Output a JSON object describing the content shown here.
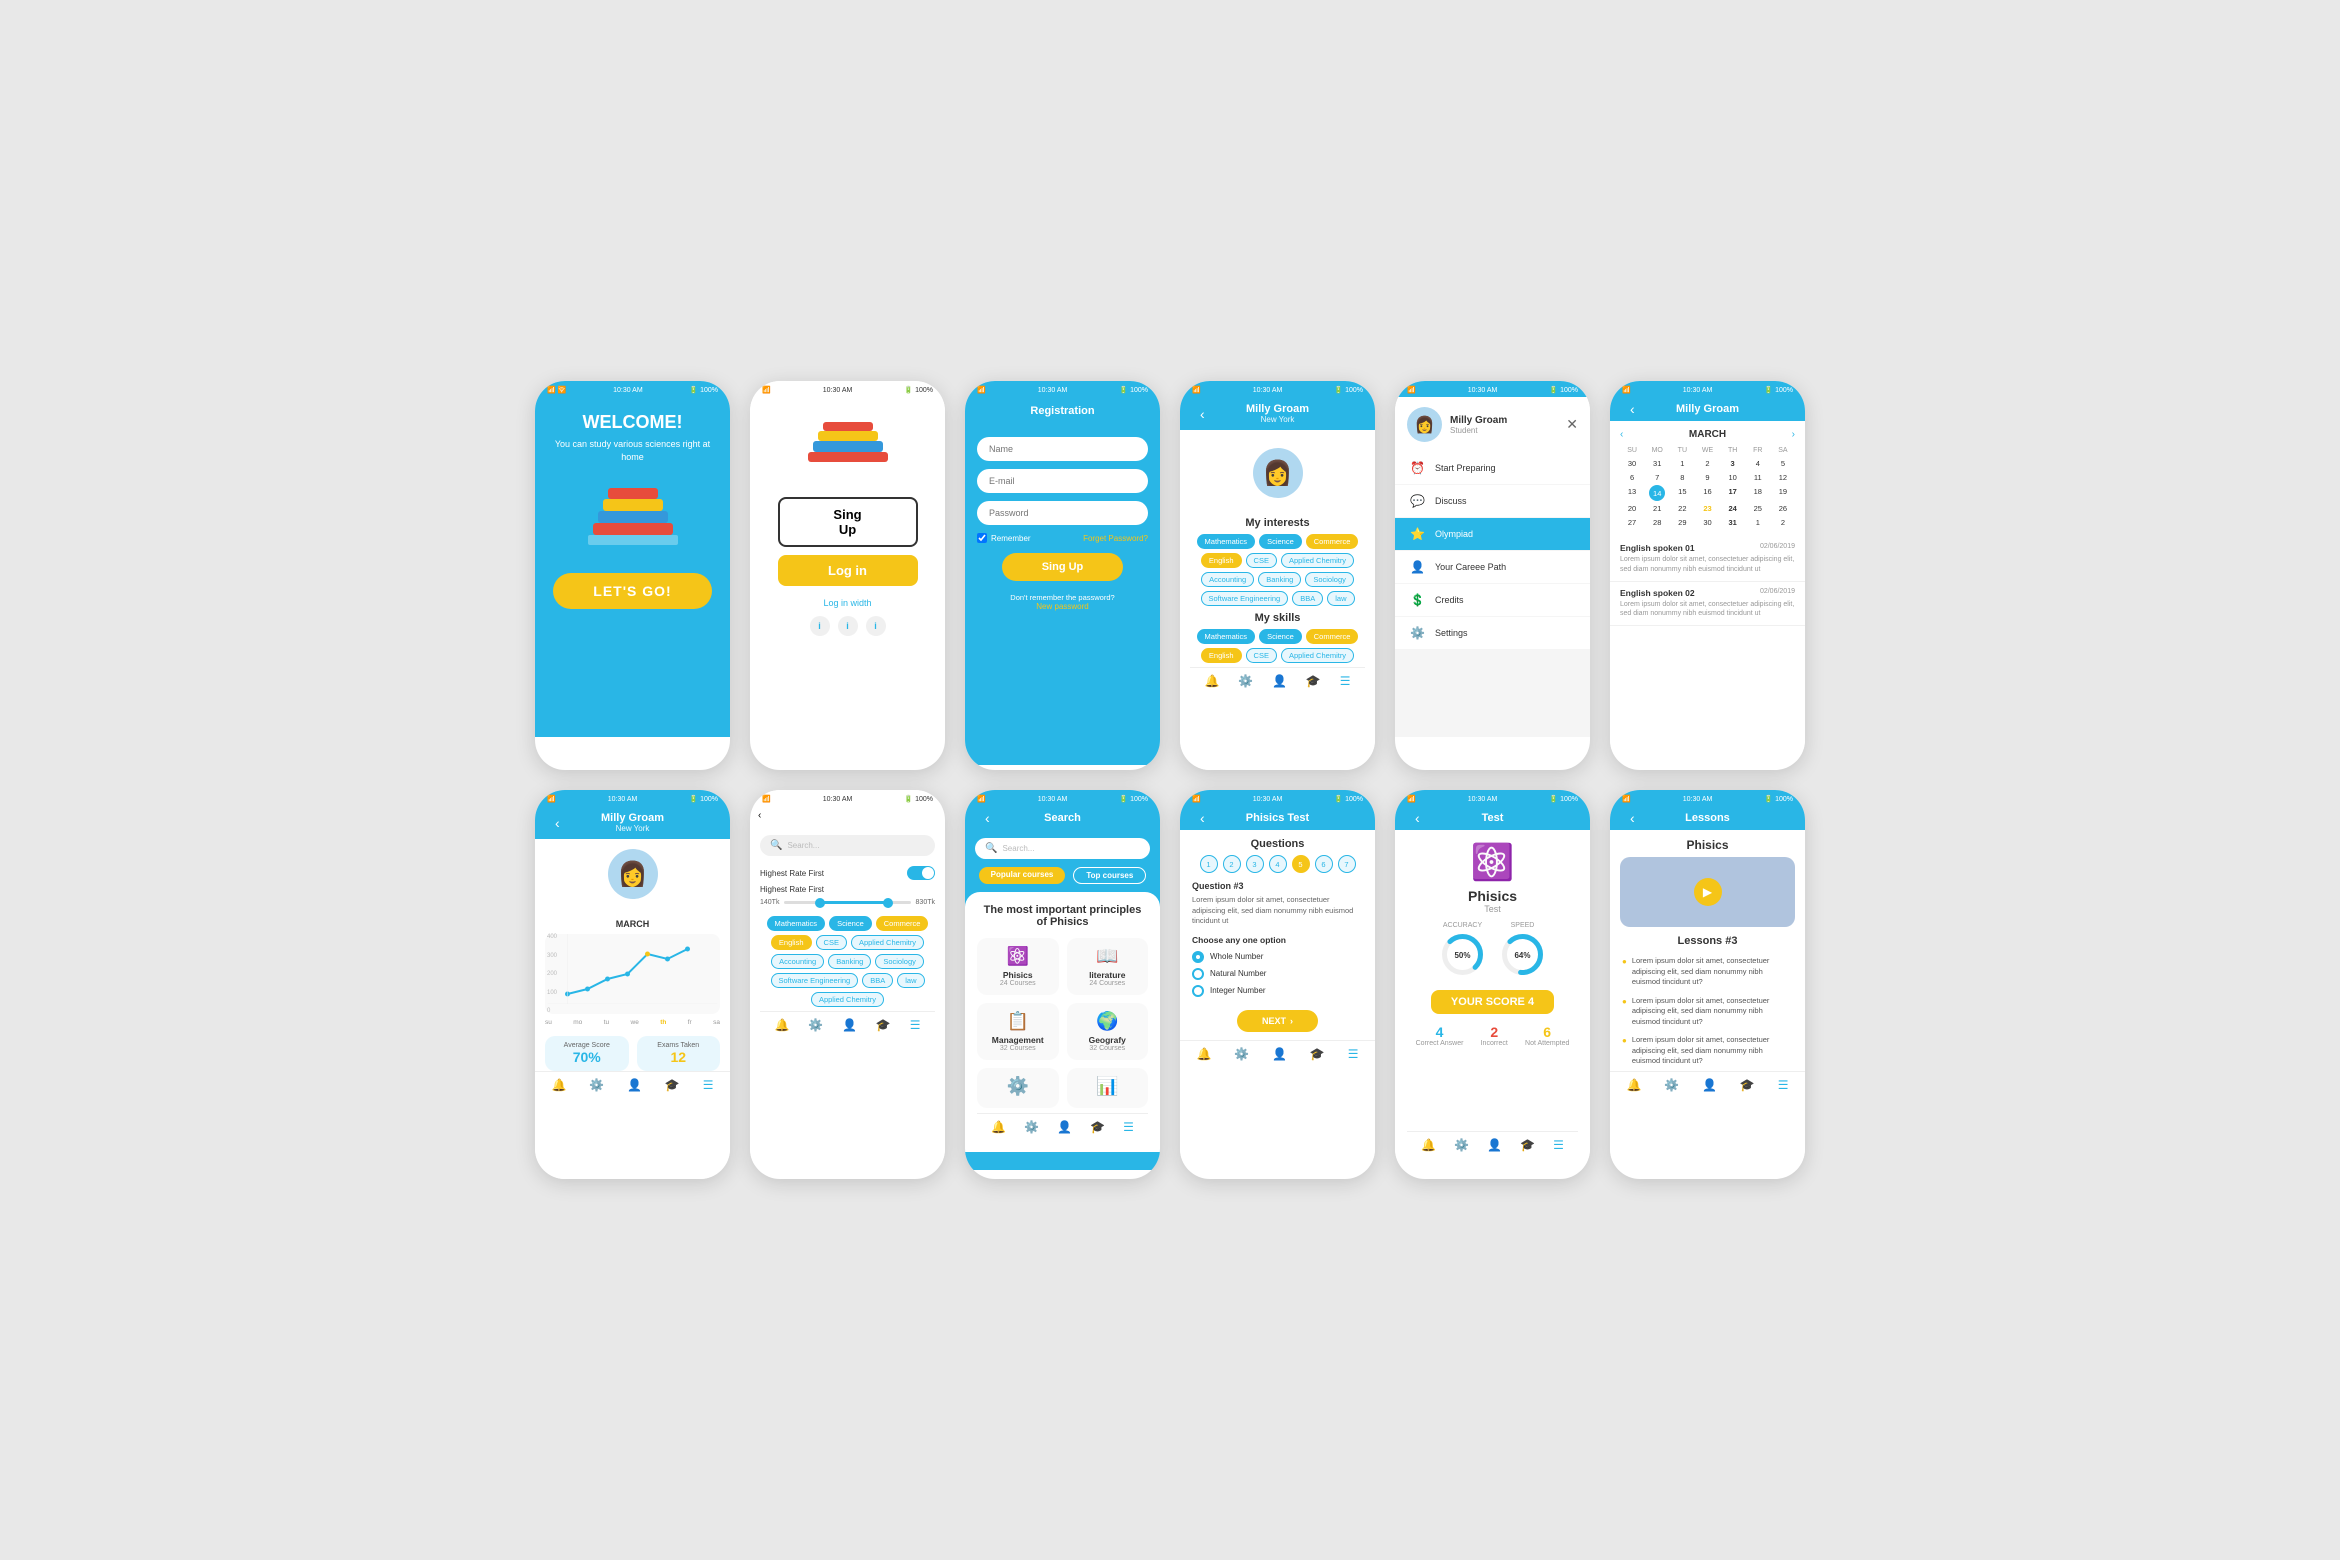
{
  "phones": {
    "welcome": {
      "status": "10:30 AM",
      "battery": "100%",
      "title": "WELCOME!",
      "subtitle": "You can study various sciences right at home",
      "cta": "LET'S GO!"
    },
    "login": {
      "status": "10:30 AM",
      "battery": "100%",
      "signup_btn": "Sing Up",
      "login_btn": "Log in",
      "login_with": "Log in width"
    },
    "registration": {
      "status": "10:30 AM",
      "battery": "100%",
      "title": "Registration",
      "name_placeholder": "Name",
      "email_placeholder": "E-mail",
      "password_placeholder": "Password",
      "remember": "Remember",
      "forgot": "Forget Password?",
      "signup_btn": "Sing Up",
      "forgot_text": "Don't remember the password?",
      "new_password": "New password"
    },
    "interests": {
      "status": "10:30 AM",
      "battery": "100%",
      "header": "Milly Groam",
      "header_sub": "New York",
      "interests_title": "My interests",
      "interests_tags": [
        "Mathematics",
        "Science",
        "Commerce",
        "English",
        "CSE",
        "Applied Chemitry",
        "Accounting",
        "Banking",
        "Sociology",
        "Software Engineering",
        "BBA",
        "law"
      ],
      "skills_title": "My skills",
      "skills_tags": [
        "Mathematics",
        "Science",
        "Commerce",
        "English",
        "CSE",
        "Applied Chemitry"
      ]
    },
    "menu": {
      "status": "10:30 AM",
      "battery": "100%",
      "user_name": "Milly Groam",
      "user_role": "Student",
      "items": [
        "Start Preparing",
        "Discuss",
        "Olympiad",
        "Your Career Path",
        "Credits",
        "Settings"
      ]
    },
    "calendar": {
      "status": "10:30 AM",
      "battery": "100%",
      "header": "Milly Groam",
      "month": "MARCH",
      "days_header": [
        "SU",
        "MO",
        "TU",
        "WE",
        "TH",
        "FR",
        "SA"
      ],
      "events": [
        {
          "title": "English spoken 01",
          "date": "02/06/2019",
          "desc": "Lorem ipsum dolor sit amet, consectetuer adipiscing elit, sed diam nonummy nibh euismod tincidunt ut"
        },
        {
          "title": "English spoken 02",
          "date": "02/06/2019",
          "desc": "Lorem ipsum dolor sit amet, consectetuer adipiscing elit, sed diam nonummy nibh euismod tincidunt ut"
        }
      ]
    },
    "profile_chart": {
      "status": "10:30 AM",
      "battery": "100%",
      "header": "Milly Groam",
      "header_sub": "New York",
      "chart_title": "MARCH",
      "chart_y": [
        "400",
        "300",
        "200",
        "100",
        "0"
      ],
      "chart_x": [
        "su",
        "mo",
        "tu",
        "we",
        "th",
        "fr",
        "sa"
      ],
      "avg_score_label": "Average Score",
      "avg_score": "70%",
      "exams_label": "Exams Taken",
      "exams": "12"
    },
    "filter": {
      "status": "10:30 AM",
      "battery": "100%",
      "search_placeholder": "Search...",
      "filter1": "Highest Rate First",
      "filter2": "Highest Rate First",
      "price_min": "140Tk",
      "price_max": "830Tk",
      "tags": [
        "Mathematics",
        "Science",
        "Commerce",
        "English",
        "CSE",
        "Applied Chemitry",
        "Accounting",
        "Banking",
        "Sociology",
        "Software Engineering",
        "BBA",
        "law",
        "Applied Chemitry"
      ]
    },
    "search": {
      "status": "10:30 AM",
      "battery": "100%",
      "title": "Search",
      "search_placeholder": "Search...",
      "tab1": "Popular courses",
      "tab2": "Top courses",
      "result_title": "The most important principles of Phisics",
      "courses": [
        {
          "name": "Phisics",
          "count": "24 Courses"
        },
        {
          "name": "literature",
          "count": "24 Courses"
        },
        {
          "name": "Management",
          "count": "32 Courses"
        },
        {
          "name": "Geografy",
          "count": "32 Courses"
        }
      ]
    },
    "test_questions": {
      "status": "10:30 AM",
      "battery": "100%",
      "header": "Phisics Test",
      "title": "Questions",
      "numbers": [
        "1",
        "2",
        "3",
        "4",
        "5",
        "6",
        "7"
      ],
      "active_num": "5",
      "question_label": "Question #3",
      "question_text": "Lorem ipsum dolor sit amet, consectetuer adipiscing elit, sed diam nonummy nibh euismod tincidunt ut",
      "choose_label": "Choose any one option",
      "options": [
        "Whole Number",
        "Natural Number",
        "Integer Number"
      ],
      "selected": "Whole Number",
      "next_btn": "NEXT"
    },
    "test_result": {
      "status": "10:30 AM",
      "battery": "100%",
      "header": "Test",
      "subject": "Phisics",
      "type": "Test",
      "accuracy_label": "ACCURACY",
      "speed_label": "SPEED",
      "accuracy": "50%",
      "speed": "64%",
      "score_label": "YOUR SCORE",
      "score": "4",
      "correct_label": "Correct Answer",
      "correct": "4",
      "incorrect_label": "Incorrect",
      "incorrect": "2",
      "not_attempted_label": "Not Attempted",
      "not_attempted": "6"
    },
    "lessons": {
      "status": "10:30 AM",
      "battery": "100%",
      "header": "Lessons",
      "subject": "Phisics",
      "lesson_label": "Lessons #3",
      "lesson_items": [
        "Lorem ipsum dolor sit amet, consectetuer adipiscing elit, sed diam nonummy nibh euismod tincidunt ut?",
        "Lorem ipsum dolor sit amet, consectetuer adipiscing elit, sed diam nonummy nibh euismod tincidunt ut?",
        "Lorem ipsum dolor sit amet, consectetuer adipiscing elit, sed diam nonummy nibh euismod tincidunt ut?"
      ]
    }
  }
}
